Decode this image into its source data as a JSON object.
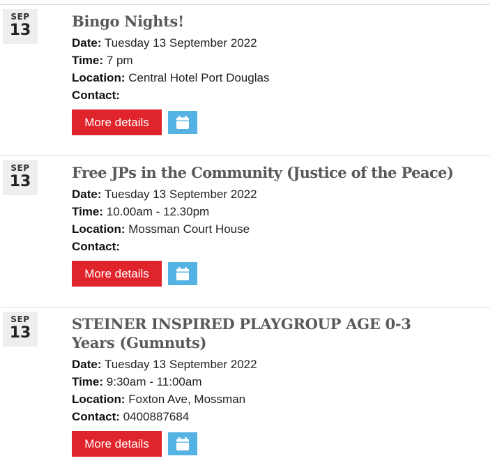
{
  "labels": {
    "date": "Date:",
    "time": "Time:",
    "location": "Location:",
    "contact": "Contact:"
  },
  "events": [
    {
      "month": "SEP",
      "day": "13",
      "title": "Bingo Nights!",
      "date": "Tuesday 13 September 2022",
      "time": "7 pm",
      "location": "Central Hotel Port Douglas",
      "contact": "",
      "more_label": "More details",
      "calendar_icon": "calendar-icon"
    },
    {
      "month": "SEP",
      "day": "13",
      "title": "Free JPs in the Community (Justice of the Peace)",
      "date": "Tuesday 13 September 2022",
      "time": "10.00am - 12.30pm",
      "location": "Mossman Court House",
      "contact": "",
      "more_label": "More details",
      "calendar_icon": "calendar-icon"
    },
    {
      "month": "SEP",
      "day": "13",
      "title": "STEINER INSPIRED PLAYGROUP AGE 0-3 Years (Gumnuts)",
      "date": "Tuesday 13 September 2022",
      "time": "9:30am - 11:00am",
      "location": "Foxton Ave, Mossman",
      "contact": "0400887684",
      "more_label": "More details",
      "calendar_icon": "calendar-icon"
    }
  ],
  "colors": {
    "more_button": "#e0242b",
    "calendar_button": "#55b3e4",
    "title": "#595959",
    "date_box": "#eeeeee"
  }
}
